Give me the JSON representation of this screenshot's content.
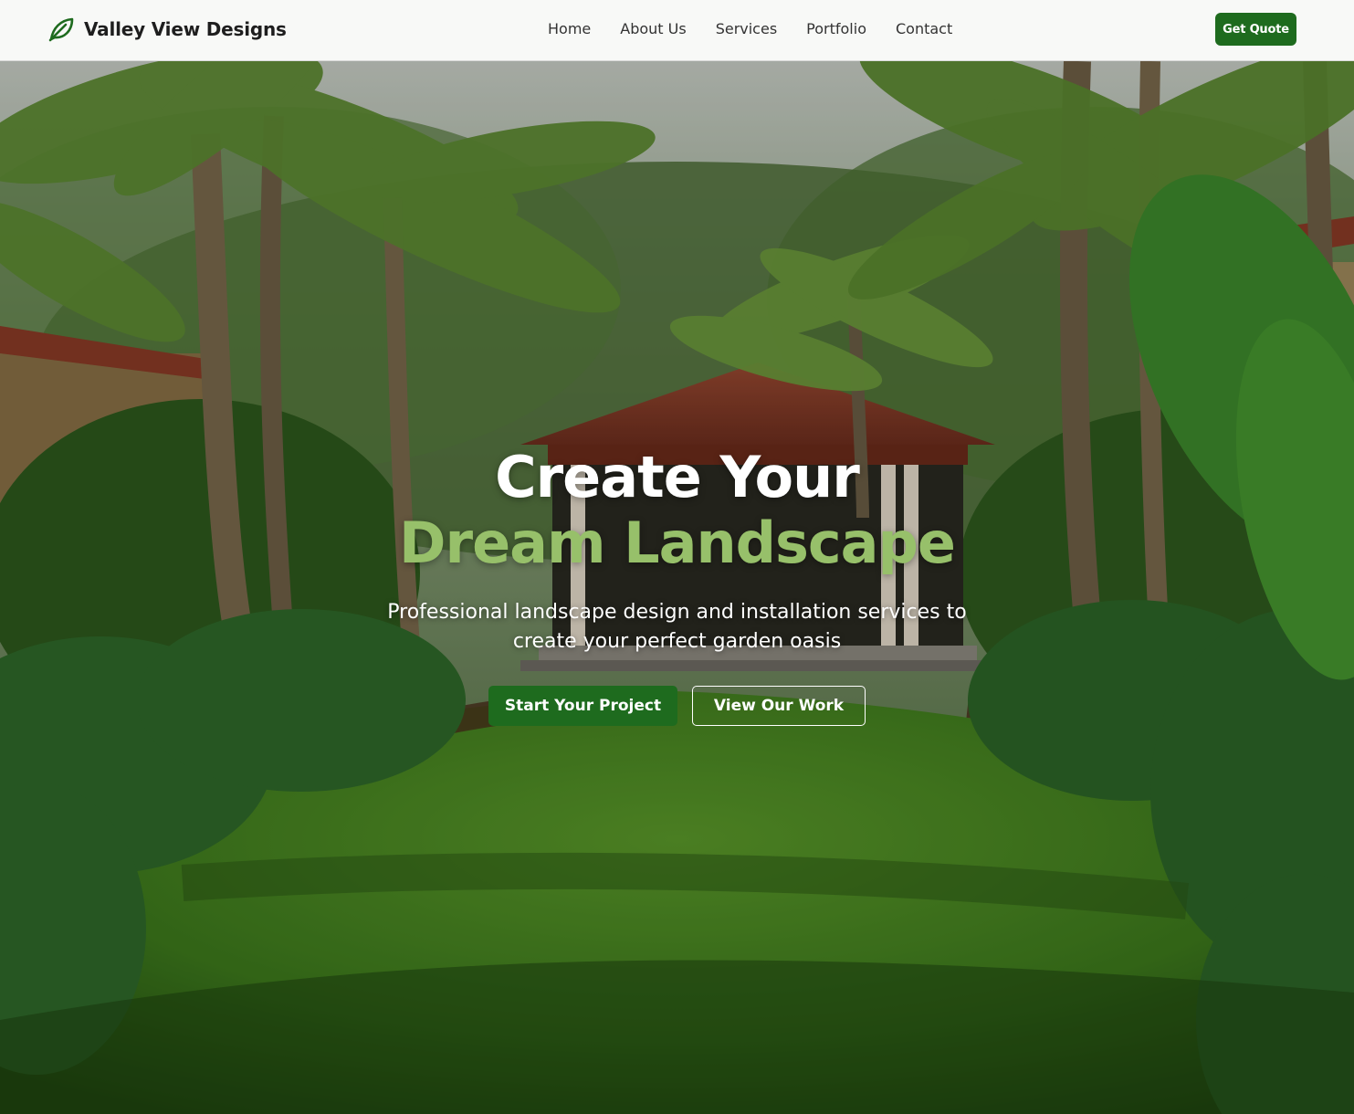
{
  "header": {
    "brand_name": "Valley View Designs",
    "logo_icon": "leaf-icon",
    "nav": [
      {
        "label": "Home"
      },
      {
        "label": "About Us"
      },
      {
        "label": "Services"
      },
      {
        "label": "Portfolio"
      },
      {
        "label": "Contact"
      }
    ],
    "cta_label": "Get Quote"
  },
  "hero": {
    "title_line1": "Create Your",
    "title_line2": "Dream Landscape",
    "subtitle": "Professional landscape design and installation services to create your perfect garden oasis",
    "primary_button": "Start Your Project",
    "secondary_button": "View Our Work",
    "background": "tropical garden with palm trees, gazebo and lawn"
  },
  "colors": {
    "brand_green": "#1e6b1e",
    "accent_light_green": "#97c06a",
    "nav_text": "#333333"
  }
}
